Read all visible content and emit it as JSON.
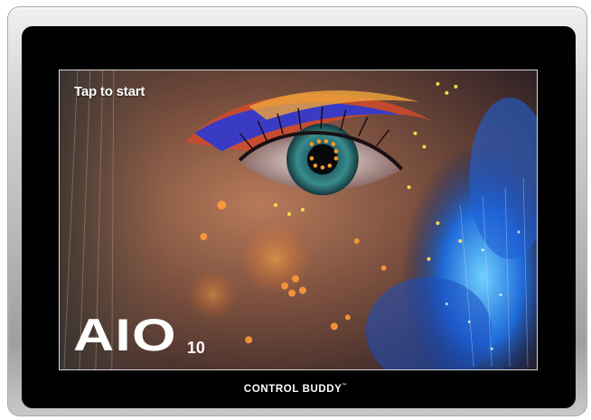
{
  "screen": {
    "tap_prompt": "Tap to start",
    "product_name": "AIO",
    "product_model": "10"
  },
  "device": {
    "brand": "CONTROL BUDDY",
    "brand_mark": "™"
  },
  "colors": {
    "bezel": "#bdbdbd",
    "frame": "#000000",
    "text": "#ffffff"
  }
}
